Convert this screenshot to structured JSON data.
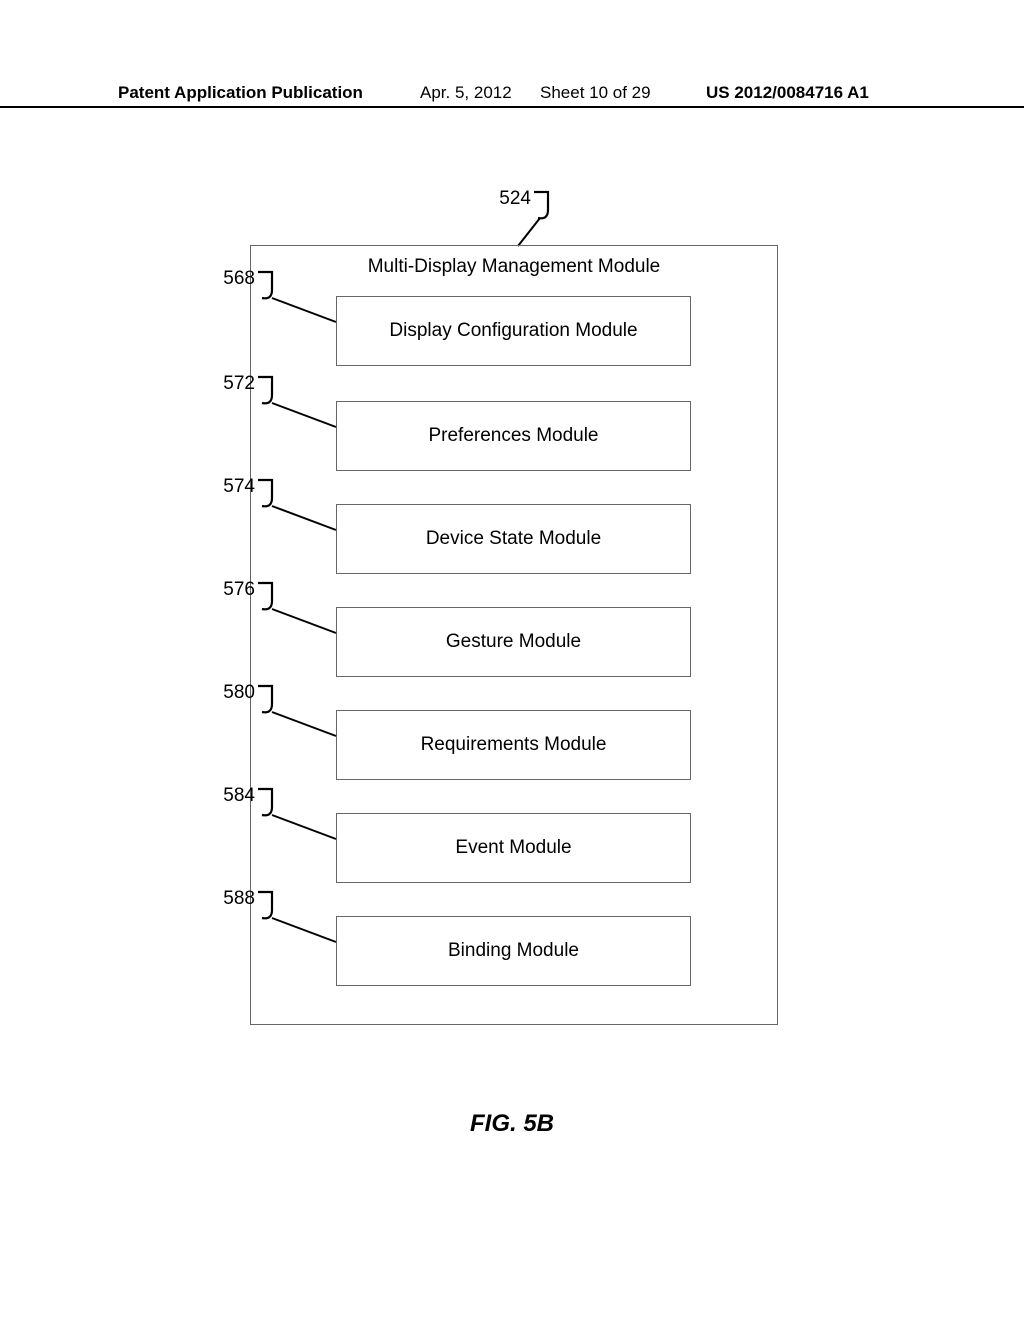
{
  "header": {
    "publication": "Patent Application Publication",
    "date": "Apr. 5, 2012",
    "sheet": "Sheet 10 of 29",
    "docnum": "US 2012/0084716 A1"
  },
  "figure": {
    "caption": "FIG. 5B",
    "outer_ref": "524",
    "outer_title": "Multi-Display Management Module",
    "modules": [
      {
        "ref": "568",
        "label": "Display Configuration Module"
      },
      {
        "ref": "572",
        "label": "Preferences Module"
      },
      {
        "ref": "574",
        "label": "Device State Module"
      },
      {
        "ref": "576",
        "label": "Gesture Module"
      },
      {
        "ref": "580",
        "label": "Requirements Module"
      },
      {
        "ref": "584",
        "label": "Event Module"
      },
      {
        "ref": "588",
        "label": "Binding Module"
      }
    ]
  }
}
